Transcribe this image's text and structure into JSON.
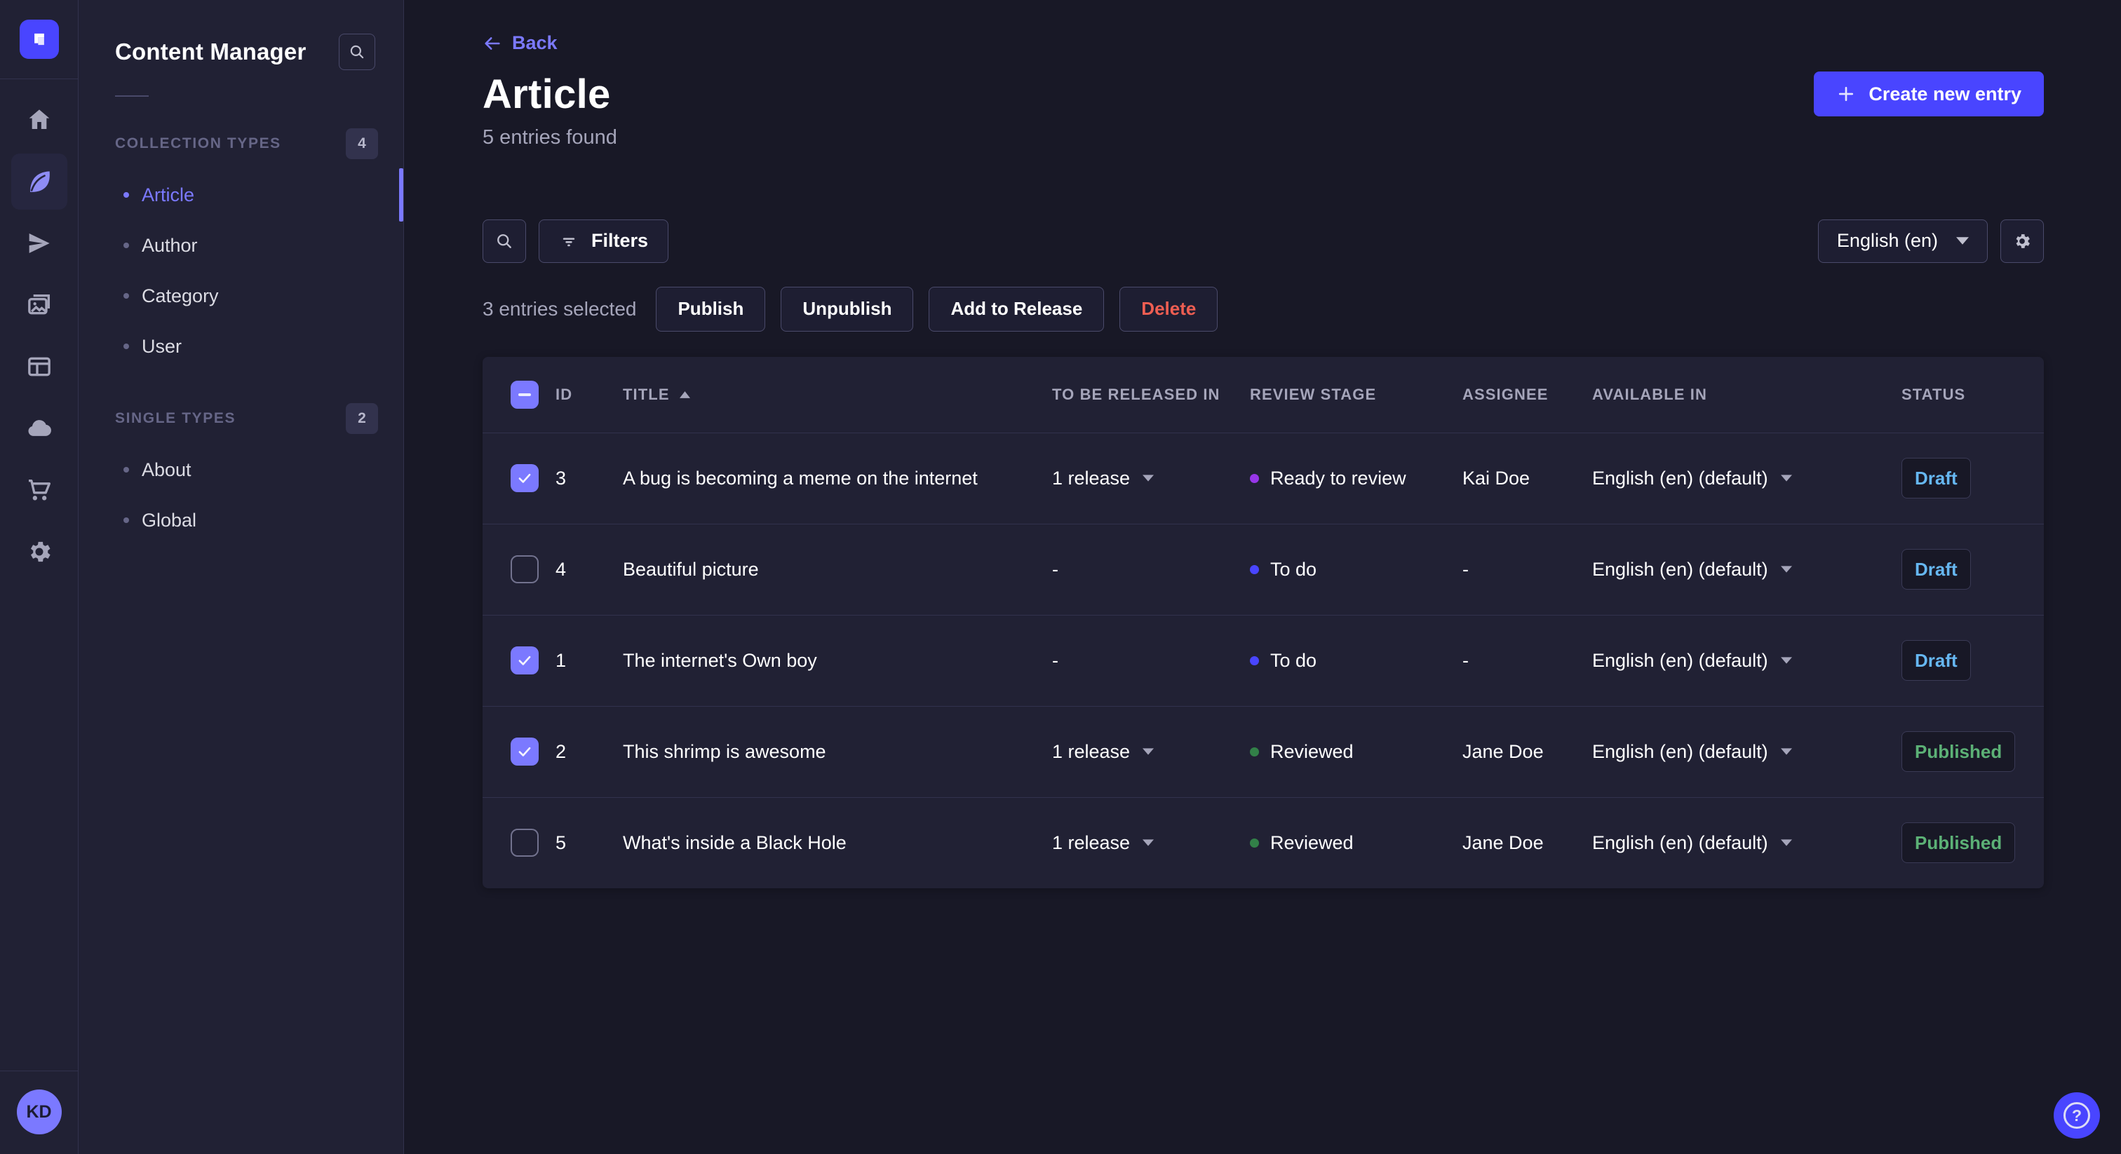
{
  "colors": {
    "primary": "#4945ff",
    "primary_light": "#7b79ff",
    "draft": "#66b7f1",
    "published": "#5cb176",
    "danger": "#ee5e52",
    "stage_todo": "#4945ff",
    "stage_ready": "#9736e8",
    "stage_reviewed": "#328048"
  },
  "rail": {
    "avatar": "KD",
    "icons": [
      "home-icon",
      "feather-icon",
      "send-icon",
      "media-icon",
      "layout-icon",
      "cloud-icon",
      "cart-icon",
      "gear-icon"
    ]
  },
  "sidebar": {
    "title": "Content Manager",
    "collection_types": {
      "label": "COLLECTION TYPES",
      "count": "4",
      "items": [
        {
          "label": "Article",
          "active": true
        },
        {
          "label": "Author",
          "active": false
        },
        {
          "label": "Category",
          "active": false
        },
        {
          "label": "User",
          "active": false
        }
      ]
    },
    "single_types": {
      "label": "SINGLE TYPES",
      "count": "2",
      "items": [
        {
          "label": "About",
          "active": false
        },
        {
          "label": "Global",
          "active": false
        }
      ]
    }
  },
  "header": {
    "back": "Back",
    "title": "Article",
    "subtitle": "5 entries found",
    "create_button": "Create new entry"
  },
  "toolbar": {
    "filters_label": "Filters",
    "locale": "English (en)"
  },
  "selection": {
    "summary": "3 entries selected",
    "publish": "Publish",
    "unpublish": "Unpublish",
    "add_to_release": "Add to Release",
    "delete": "Delete"
  },
  "table": {
    "columns": {
      "id": "ID",
      "title": "TITLE",
      "released": "TO BE RELEASED IN",
      "review": "REVIEW STAGE",
      "assignee": "ASSIGNEE",
      "available": "AVAILABLE IN",
      "status": "STATUS"
    },
    "rows": [
      {
        "id": "3",
        "title": "A bug is becoming a meme on the internet",
        "released": "1 release",
        "review": "Ready to review",
        "review_color": "#9736e8",
        "assignee": "Kai Doe",
        "available": "English (en) (default)",
        "status": "Draft",
        "selected": true
      },
      {
        "id": "4",
        "title": "Beautiful picture",
        "released": "-",
        "review": "To do",
        "review_color": "#4945ff",
        "assignee": "-",
        "available": "English (en) (default)",
        "status": "Draft",
        "selected": false
      },
      {
        "id": "1",
        "title": "The internet's Own boy",
        "released": "-",
        "review": "To do",
        "review_color": "#4945ff",
        "assignee": "-",
        "available": "English (en) (default)",
        "status": "Draft",
        "selected": true
      },
      {
        "id": "2",
        "title": "This shrimp is awesome",
        "released": "1 release",
        "review": "Reviewed",
        "review_color": "#328048",
        "assignee": "Jane Doe",
        "available": "English (en) (default)",
        "status": "Published",
        "selected": true
      },
      {
        "id": "5",
        "title": "What's inside a Black Hole",
        "released": "1 release",
        "review": "Reviewed",
        "review_color": "#328048",
        "assignee": "Jane Doe",
        "available": "English (en) (default)",
        "status": "Published",
        "selected": false
      }
    ]
  }
}
